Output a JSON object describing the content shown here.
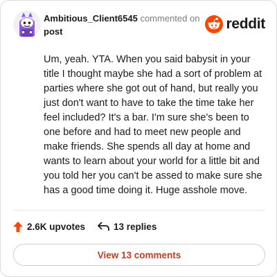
{
  "colors": {
    "upvote_arrow": "#ff4500",
    "reddit_orange": "#ff4500",
    "view_link": "#c83a1e",
    "avatar_purple": "#8a5bd6"
  },
  "comment": {
    "username": "Ambitious_Client6545",
    "action_text": "commented on",
    "post_link": "post",
    "body": "Um, yeah. YTA. When you said babysit in your title I thought maybe she had a sort of problem at parties where she got out of hand, but really you just don't want to have to take the time take her feel included? It's a bar. I'm sure she's been to one before and had to meet new people and make friends. She spends all day at home and wants to learn about your world for a little bit and you told her you can't be assed to make sure she has a good time doing it. Huge asshole move.",
    "upvotes": "2.6K upvotes",
    "replies": "13 replies",
    "view_button": "View 13 comments"
  },
  "brand": {
    "logo_text": "reddit",
    "logo_icon": "reddit-snoo-icon"
  },
  "icons": {
    "upvote": "upvote-arrow-icon",
    "reply": "reply-arrow-icon",
    "avatar": "snoo-avatar-icon"
  }
}
